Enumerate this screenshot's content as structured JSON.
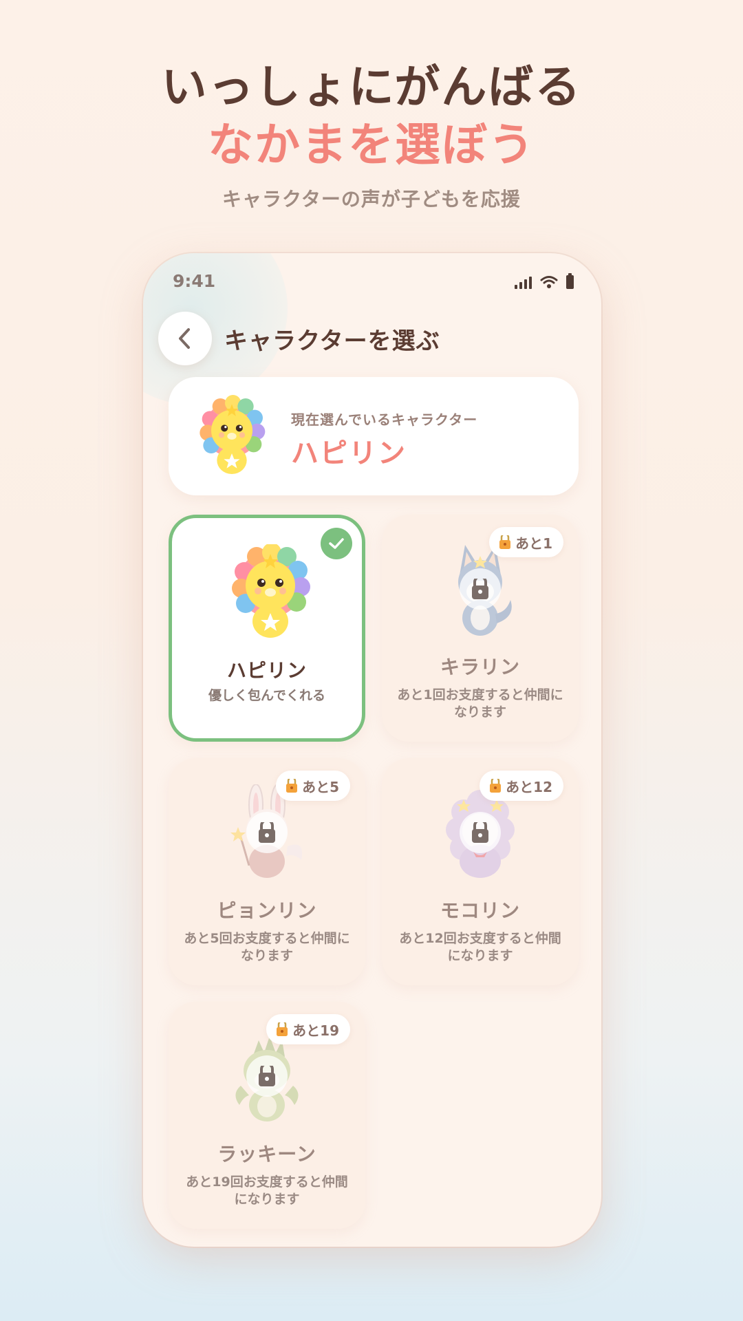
{
  "headline": {
    "line1": "いっしょにがんばる",
    "line2": "なかまを選ぼう",
    "subtitle": "キャラクターの声が子どもを応援"
  },
  "status_bar": {
    "time": "9:41"
  },
  "nav": {
    "title": "キャラクターを選ぶ"
  },
  "current": {
    "label": "現在選んでいるキャラクター",
    "name": "ハピリン"
  },
  "characters": [
    {
      "name": "ハピリン",
      "desc": "優しく包んでくれる",
      "selected": true
    },
    {
      "name": "キラリン",
      "desc": "あと1回お支度すると仲間になります",
      "badge": "あと1",
      "locked": true
    },
    {
      "name": "ピョンリン",
      "desc": "あと5回お支度すると仲間になります",
      "badge": "あと5",
      "locked": true
    },
    {
      "name": "モコリン",
      "desc": "あと12回お支度すると仲間になります",
      "badge": "あと12",
      "locked": true
    },
    {
      "name": "ラッキーン",
      "desc": "あと19回お支度すると仲間になります",
      "badge": "あと19",
      "locked": true
    }
  ],
  "colors": {
    "accent": "#f2847a",
    "selected_border": "#7cc07f",
    "text_dark": "#5b3c32"
  }
}
